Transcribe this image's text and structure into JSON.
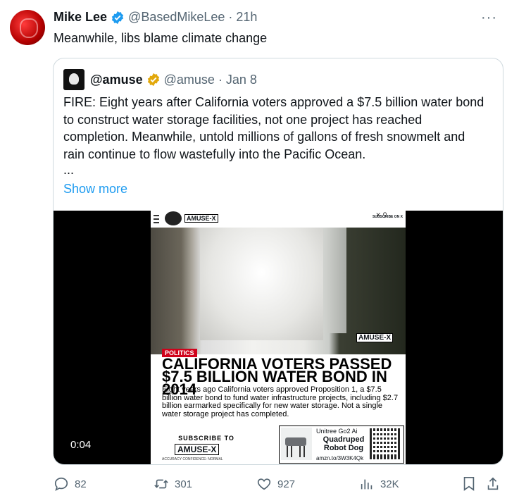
{
  "author": {
    "name": "Mike Lee",
    "handle": "@BasedMikeLee",
    "time": "21h",
    "avatar_icon": "red-portrait-avatar"
  },
  "tweet_text": "Meanwhile, libs blame climate change",
  "more_label": "···",
  "quoted": {
    "name": "@amuse",
    "handle": "@amuse",
    "date": "Jan 8",
    "text": "FIRE: Eight years after California voters approved a $7.5 billion water bond to construct water storage facilities, not one project has reached completion. Meanwhile, untold millions of gallons of fresh snowmelt and rain continue to flow wastefully into the Pacific Ocean.",
    "ellipsis": "...",
    "show_more": "Show more",
    "video": {
      "timestamp": "0:04",
      "brand": "AMUSE-X",
      "subscribe_top": "SUBSCRIBE ON X",
      "category": "POLITICS",
      "headline": "CALIFORNIA VOTERS PASSED $7.5 BILLION WATER BOND IN 2014",
      "body": "Eight years ago California voters approved Proposition 1, a $7.5 billion water bond to fund water infrastructure projects, including $2.7 billion earmarked specifically for new water storage. Not a single water storage project has completed.",
      "subscribe_to": "SUBSCRIBE TO",
      "accuracy": "ACCURACY CONFIDENCE: NORMAL",
      "ad": {
        "line1": "Unitree Go2 Ai",
        "title": "Quadruped Robot Dog",
        "link": "amzn.to/3W3K4Qk"
      }
    }
  },
  "actions": {
    "replies": "82",
    "reposts": "301",
    "likes": "927",
    "views": "32K"
  },
  "colors": {
    "accent": "#1d9bf0",
    "muted": "#536471",
    "gold": "#e2a80b"
  }
}
